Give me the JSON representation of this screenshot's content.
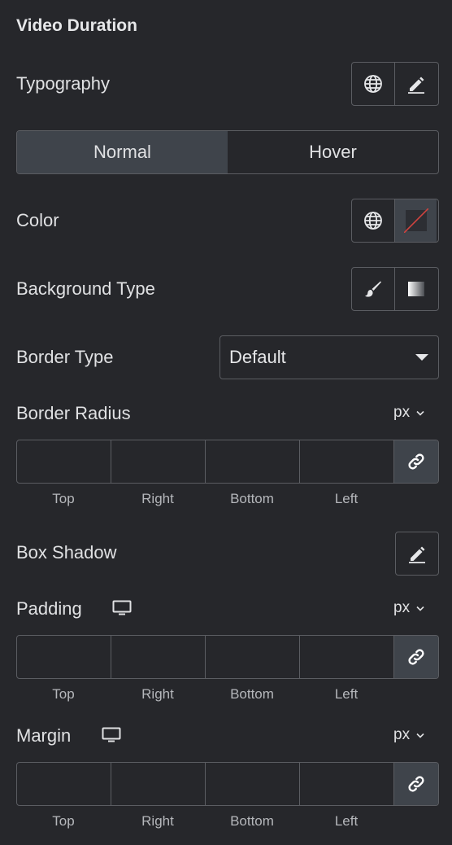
{
  "section": {
    "title": "Video Duration"
  },
  "typography": {
    "label": "Typography",
    "global_icon": "globe-icon",
    "edit_icon": "pencil-icon"
  },
  "state_tabs": [
    {
      "label": "Normal",
      "active": true
    },
    {
      "label": "Hover",
      "active": false
    }
  ],
  "color": {
    "label": "Color",
    "global_icon": "globe-icon",
    "swatch_icon": "empty-color-swatch-icon"
  },
  "background_type": {
    "label": "Background Type",
    "options": [
      "classic-brush-icon",
      "gradient-icon"
    ]
  },
  "border_type": {
    "label": "Border Type",
    "value": "Default"
  },
  "border_radius": {
    "label": "Border Radius",
    "unit": "px",
    "fields": [
      "Top",
      "Right",
      "Bottom",
      "Left"
    ]
  },
  "box_shadow": {
    "label": "Box Shadow",
    "edit_icon": "pencil-icon"
  },
  "padding": {
    "label": "Padding",
    "unit": "px",
    "device_icon": "desktop-icon",
    "fields": [
      "Top",
      "Right",
      "Bottom",
      "Left"
    ]
  },
  "margin": {
    "label": "Margin",
    "unit": "px",
    "device_icon": "desktop-icon",
    "fields": [
      "Top",
      "Right",
      "Bottom",
      "Left"
    ]
  },
  "colors": {
    "background": "#26272b",
    "border": "#5b5d62",
    "active": "#3f444b",
    "text": "#e0e1e3"
  }
}
